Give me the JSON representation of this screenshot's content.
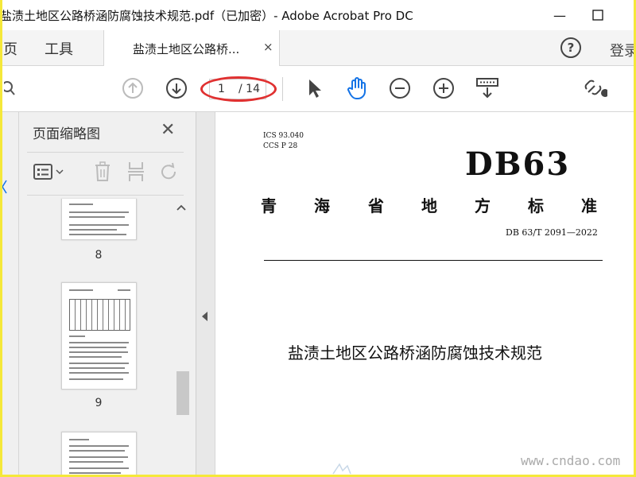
{
  "window": {
    "title": "盐渍土地区公路桥涵防腐蚀技术规范.pdf（已加密）- Adobe Acrobat Pro DC",
    "minimize_glyph": "—",
    "maximize_glyph": "☐"
  },
  "tabs": {
    "home_label": "页",
    "tools_label": "工具",
    "doc_tab_label": "盐渍土地区公路桥...",
    "close_glyph": "×",
    "help_glyph": "?",
    "login_label": "登录"
  },
  "toolbar": {
    "current_page": "1",
    "total_pages": "/ 14",
    "icons": [
      "prev-page-icon",
      "next-page-icon",
      "select-arrow-icon",
      "hand-tool-icon",
      "zoom-out-icon",
      "zoom-in-icon",
      "page-display-icon",
      "share-link-icon"
    ]
  },
  "sidebar": {
    "title": "页面缩略图",
    "close_glyph": "✕",
    "thumbnails": [
      {
        "label": "8"
      },
      {
        "label": "9"
      }
    ]
  },
  "document": {
    "ics": "ICS 93.040",
    "ccs": "CCS P 28",
    "header": "DB63",
    "standard_chars": [
      "青",
      "海",
      "省",
      "地",
      "方",
      "标",
      "准"
    ],
    "code": "DB 63/T 2091—2022",
    "title": "盐渍土地区公路桥涵防腐蚀技术规范"
  },
  "watermark": {
    "text": "www.cndao.com"
  },
  "colors": {
    "accent": "#1473e6",
    "highlight_ring": "#e03030",
    "frame": "#f5e83a"
  }
}
